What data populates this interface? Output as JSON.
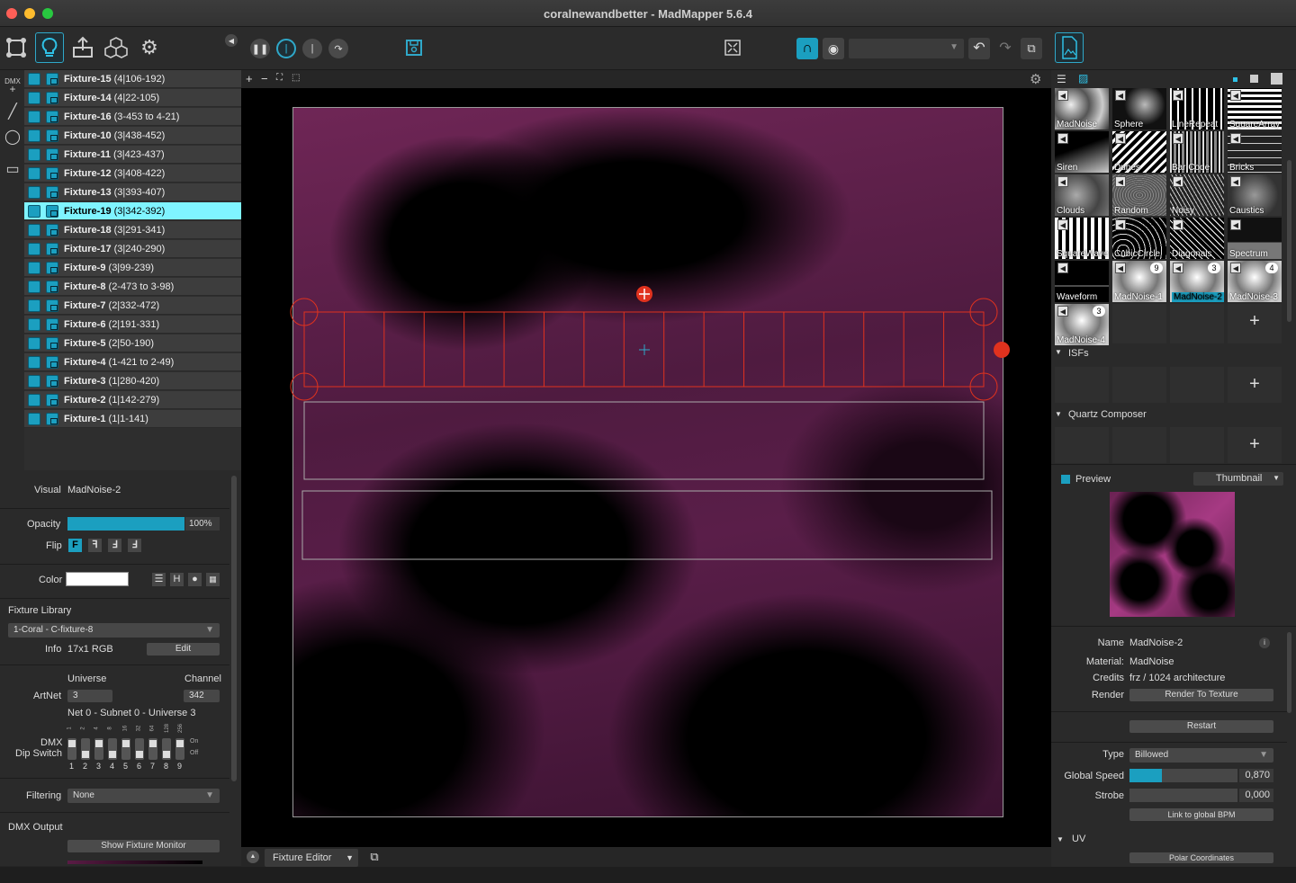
{
  "window": {
    "title": "coralnewandbetter - MadMapper 5.6.4"
  },
  "fixtures": [
    {
      "name": "Fixture-15",
      "range": "(4|106-192)"
    },
    {
      "name": "Fixture-14",
      "range": "(4|22-105)"
    },
    {
      "name": "Fixture-16",
      "range": "(3-453 to 4-21)"
    },
    {
      "name": "Fixture-10",
      "range": "(3|438-452)"
    },
    {
      "name": "Fixture-11",
      "range": "(3|423-437)"
    },
    {
      "name": "Fixture-12",
      "range": "(3|408-422)"
    },
    {
      "name": "Fixture-13",
      "range": "(3|393-407)"
    },
    {
      "name": "Fixture-19",
      "range": "(3|342-392)"
    },
    {
      "name": "Fixture-18",
      "range": "(3|291-341)"
    },
    {
      "name": "Fixture-17",
      "range": "(3|240-290)"
    },
    {
      "name": "Fixture-9",
      "range": "(3|99-239)"
    },
    {
      "name": "Fixture-8",
      "range": "(2-473 to 3-98)"
    },
    {
      "name": "Fixture-7",
      "range": "(2|332-472)"
    },
    {
      "name": "Fixture-6",
      "range": "(2|191-331)"
    },
    {
      "name": "Fixture-5",
      "range": "(2|50-190)"
    },
    {
      "name": "Fixture-4",
      "range": "(1-421 to 2-49)"
    },
    {
      "name": "Fixture-3",
      "range": "(1|280-420)"
    },
    {
      "name": "Fixture-2",
      "range": "(1|142-279)"
    },
    {
      "name": "Fixture-1",
      "range": "(1|1-141)"
    }
  ],
  "selected_fixture_index": 7,
  "left_tools": {
    "dmx": "DMX"
  },
  "props": {
    "visual_label": "Visual",
    "visual_value": "MadNoise-2",
    "opacity_label": "Opacity",
    "opacity_value": "100%",
    "opacity_level": 1.0,
    "flip_label": "Flip",
    "color_label": "Color",
    "color_value": "#ffffff",
    "color_mode_h": "H",
    "fixture_library_label": "Fixture Library",
    "fixture_library_value": "1-Coral - C-fixture-8",
    "info_label": "Info",
    "info_value": "17x1 RGB",
    "edit_label": "Edit",
    "universe_label": "Universe",
    "channel_label": "Channel",
    "artnet_label": "ArtNet",
    "artnet_universe": "3",
    "artnet_channel": "342",
    "net_text": "Net 0 - Subnet 0 - Universe 3",
    "dmx_label": "DMX",
    "dip_label": "Dip Switch",
    "dip_top": [
      "1",
      "2",
      "4",
      "8",
      "16",
      "32",
      "64",
      "128",
      "256"
    ],
    "dip_numbers": [
      "1",
      "2",
      "3",
      "4",
      "5",
      "6",
      "7",
      "8",
      "9"
    ],
    "on_label": "On",
    "off_label": "Off",
    "filtering_label": "Filtering",
    "filtering_value": "None",
    "dmx_output_label": "DMX Output",
    "show_monitor_label": "Show Fixture Monitor"
  },
  "bottom": {
    "mode": "Fixture Editor"
  },
  "materials": [
    {
      "label": "MadNoise",
      "badge": ""
    },
    {
      "label": "Sphere",
      "badge": ""
    },
    {
      "label": "LineRepeat",
      "badge": ""
    },
    {
      "label": "SquareArray",
      "badge": ""
    },
    {
      "label": "Siren",
      "badge": ""
    },
    {
      "label": "Dunes",
      "badge": ""
    },
    {
      "label": "Bar Code",
      "badge": ""
    },
    {
      "label": "Bricks",
      "badge": ""
    },
    {
      "label": "Clouds",
      "badge": ""
    },
    {
      "label": "Random",
      "badge": ""
    },
    {
      "label": "Noisy",
      "badge": ""
    },
    {
      "label": "Caustics",
      "badge": ""
    },
    {
      "label": "SquareWave",
      "badge": ""
    },
    {
      "label": "CubicCircle",
      "badge": ""
    },
    {
      "label": "Diagonals",
      "badge": ""
    },
    {
      "label": "Spectrum",
      "badge": ""
    },
    {
      "label": "Waveform",
      "badge": ""
    },
    {
      "label": "MadNoise-1",
      "badge": "9"
    },
    {
      "label": "MadNoise-2",
      "badge": "3"
    },
    {
      "label": "MadNoise-3",
      "badge": "4"
    },
    {
      "label": "MadNoise-4",
      "badge": "3"
    }
  ],
  "sections": {
    "isf": "ISFs",
    "qc": "Quartz Composer",
    "uv": "UV"
  },
  "preview": {
    "label": "Preview",
    "mode": "Thumbnail"
  },
  "material_info": {
    "name_label": "Name",
    "name_value": "MadNoise-2",
    "material_label": "Material:",
    "material_value": "MadNoise",
    "credits_label": "Credits",
    "credits_value": "frz / 1024 architecture",
    "render_label": "Render",
    "render_value": "Render  To Texture",
    "restart_label": "Restart",
    "type_label": "Type",
    "type_value": "Billowed",
    "speed_label": "Global Speed",
    "speed_value": "0,870",
    "speed_level": 0.3,
    "strobe_label": "Strobe",
    "strobe_value": "0,000",
    "strobe_level": 0,
    "bpm_label": "Link to global BPM",
    "polar_label": "Polar Coordinates"
  }
}
